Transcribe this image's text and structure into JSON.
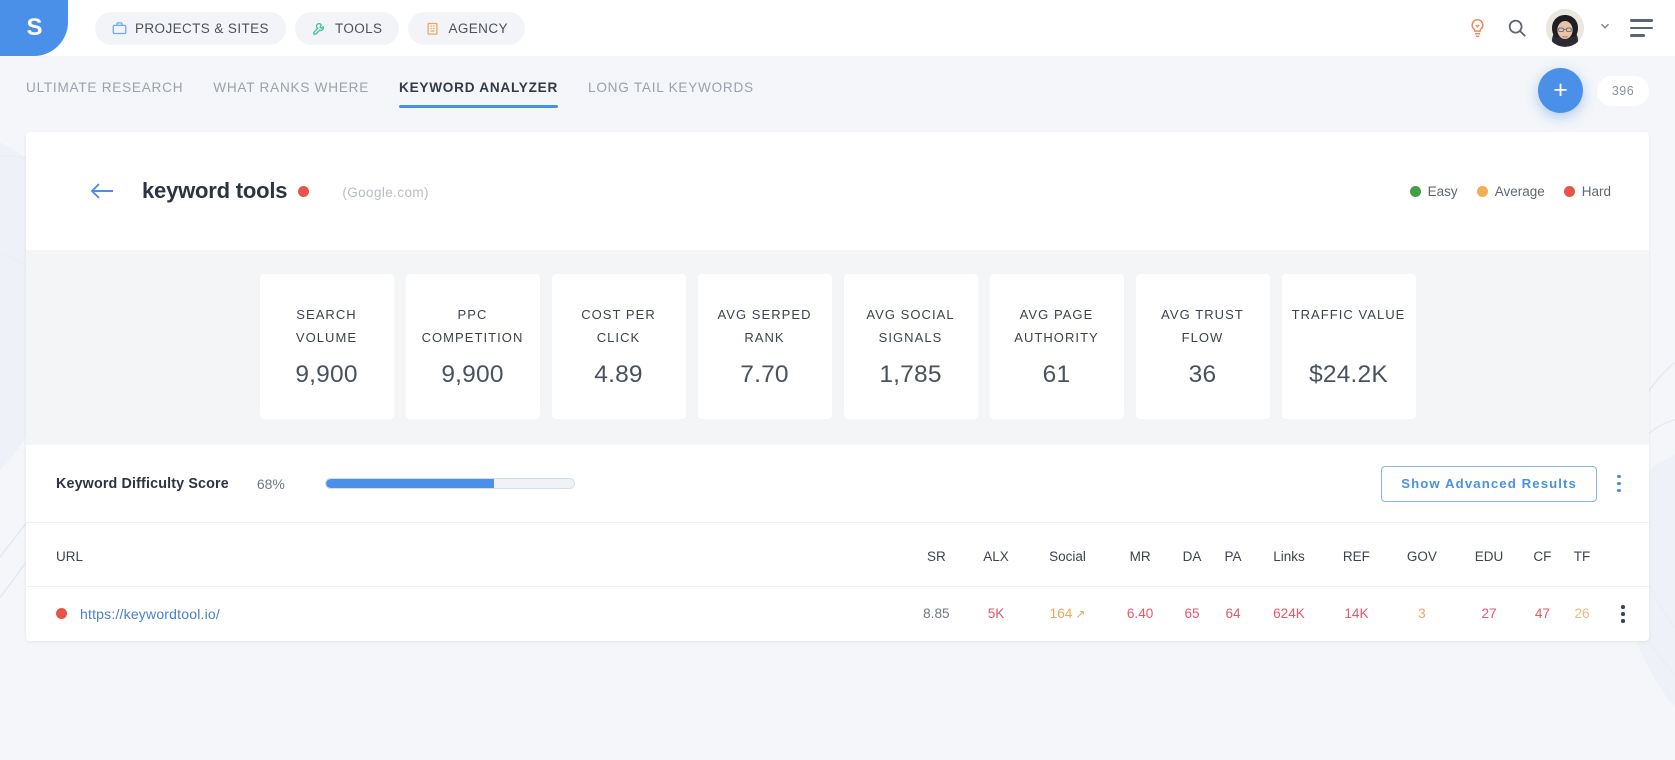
{
  "brand": {
    "logo_glyph": "S",
    "accent": "#4a90e8"
  },
  "header": {
    "nav_pills": [
      {
        "label": "PROJECTS & SITES",
        "icon": "briefcase-icon",
        "icon_color": "#6ba9e8"
      },
      {
        "label": "TOOLS",
        "icon": "wrench-icon",
        "icon_color": "#3ec29a"
      },
      {
        "label": "AGENCY",
        "icon": "building-icon",
        "icon_color": "#f0a35e"
      }
    ],
    "icons": {
      "ideas": "lightbulb-icon",
      "ideas_color": "#ef8a5c",
      "search": "search-icon",
      "avatar": "user-avatar",
      "chevron": "chevron-down-icon",
      "menu": "hamburger-menu-icon"
    }
  },
  "tabs": [
    {
      "label": "ULTIMATE RESEARCH",
      "active": false
    },
    {
      "label": "WHAT RANKS WHERE",
      "active": false
    },
    {
      "label": "KEYWORD ANALYZER",
      "active": true
    },
    {
      "label": "LONG TAIL KEYWORDS",
      "active": false
    }
  ],
  "toolbar": {
    "add_label": "+",
    "count_badge": "396"
  },
  "keyword": {
    "back_icon": "arrow-left-icon",
    "title": "keyword tools",
    "difficulty_dot": "hard",
    "engine": "(Google.com)"
  },
  "legend": [
    {
      "label": "Easy",
      "color": "#43a047"
    },
    {
      "label": "Average",
      "color": "#f2ae4f"
    },
    {
      "label": "Hard",
      "color": "#e8544a"
    }
  ],
  "metrics": [
    {
      "label": "SEARCH VOLUME",
      "value": "9,900"
    },
    {
      "label": "PPC COMPETITION",
      "value": "9,900"
    },
    {
      "label": "COST PER CLICK",
      "value": "4.89"
    },
    {
      "label": "AVG SERPED RANK",
      "value": "7.70"
    },
    {
      "label": "AVG SOCIAL SIGNALS",
      "value": "1,785"
    },
    {
      "label": "AVG PAGE AUTHORITY",
      "value": "61"
    },
    {
      "label": "AVG TRUST FLOW",
      "value": "36"
    },
    {
      "label": "TRAFFIC VALUE",
      "value": "$24.2K"
    }
  ],
  "difficulty": {
    "label": "Keyword Difficulty Score",
    "percent_text": "68%",
    "percent_value": 68,
    "advanced_button": "Show Advanced Results",
    "kebab_icon": "more-options-icon"
  },
  "table": {
    "headers": [
      "URL",
      "SR",
      "ALX",
      "Social",
      "MR",
      "DA",
      "PA",
      "Links",
      "REF",
      "GOV",
      "EDU",
      "CF",
      "TF"
    ],
    "rows": [
      {
        "dot": "hard",
        "url": "https://keywordtool.io/",
        "sr": "8.85",
        "alx": "5K",
        "social": "164",
        "social_trend": "↗",
        "mr": "6.40",
        "da": "65",
        "pa": "64",
        "links": "624K",
        "ref": "14K",
        "gov": "3",
        "edu": "27",
        "cf": "47",
        "tf": "26",
        "kebab_icon": "more-options-icon"
      }
    ]
  }
}
